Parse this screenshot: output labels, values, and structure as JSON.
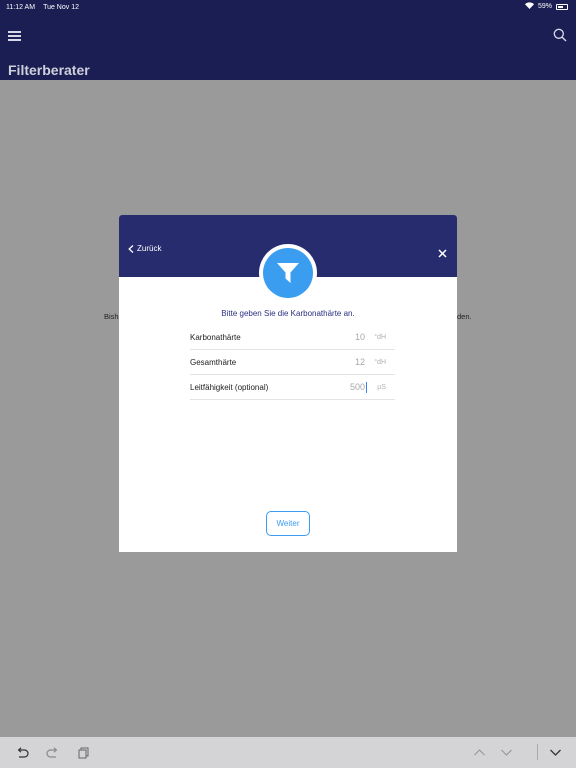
{
  "status": {
    "time": "11:12 AM",
    "date": "Tue Nov 12",
    "battery": "59%"
  },
  "header": {
    "title": "Filterberater"
  },
  "background": {
    "left_text": "Bish",
    "right_text": "den."
  },
  "modal": {
    "back_label": "Zurück",
    "prompt": "Bitte geben Sie die Karbonathärte an.",
    "fields": [
      {
        "label": "Karbonathärte",
        "value": "10",
        "unit": "°dH"
      },
      {
        "label": "Gesamthärte",
        "value": "12",
        "unit": "°dH"
      },
      {
        "label": "Leitfähigkeit (optional)",
        "value": "500",
        "unit": "µS"
      }
    ],
    "next_label": "Weiter"
  },
  "colors": {
    "header": "#1a1e52",
    "modal_header": "#272c6e",
    "accent": "#3a9df0"
  }
}
